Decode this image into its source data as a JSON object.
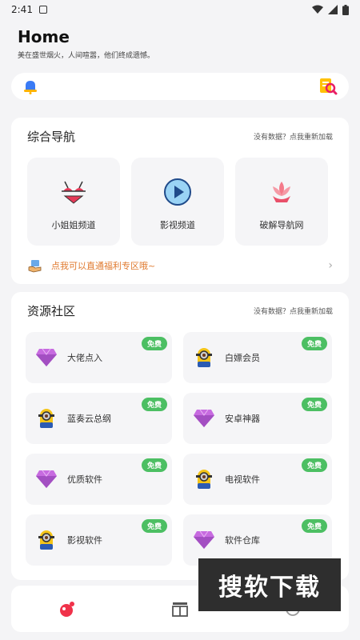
{
  "status_bar": {
    "time": "2:41"
  },
  "header": {
    "title": "Home",
    "subtitle": "美在盛世烟火，人间喧嚣，他们终成遗憾。"
  },
  "search": {
    "left_icon": "bell-icon",
    "right_icon": "search-doc-icon"
  },
  "nav_card": {
    "title": "综合导航",
    "hint": "没有数据？点我重新加载",
    "tiles": [
      {
        "label": "小姐姐频道",
        "icon": "bikini-icon"
      },
      {
        "label": "影视频道",
        "icon": "play-icon"
      },
      {
        "label": "破解导航网",
        "icon": "lotus-icon"
      }
    ],
    "promo_text": "点我可以直通福利专区哦~"
  },
  "res_card": {
    "title": "资源社区",
    "hint": "没有数据？点我重新加载",
    "items": [
      {
        "label": "大佬点入",
        "icon": "gem-icon",
        "badge": "免费"
      },
      {
        "label": "白嫖会员",
        "icon": "minion-icon",
        "badge": "免费"
      },
      {
        "label": "蓝奏云总纲",
        "icon": "minion-icon",
        "badge": "免费"
      },
      {
        "label": "安卓神器",
        "icon": "gem-icon",
        "badge": "免费"
      },
      {
        "label": "优质软件",
        "icon": "gem-icon",
        "badge": "免费"
      },
      {
        "label": "电视软件",
        "icon": "minion-icon",
        "badge": "免费"
      },
      {
        "label": "影视软件",
        "icon": "minion-icon",
        "badge": "免费"
      },
      {
        "label": "软件仓库",
        "icon": "gem-icon",
        "badge": "免费"
      }
    ]
  },
  "bottom_nav": [
    {
      "icon": "home-icon"
    },
    {
      "icon": "list-icon"
    },
    {
      "icon": "profile-icon"
    }
  ],
  "watermark": "搜软下载",
  "colors": {
    "accent": "#4cbf63",
    "promo": "#e07a2f",
    "background": "#f4f4f6"
  }
}
